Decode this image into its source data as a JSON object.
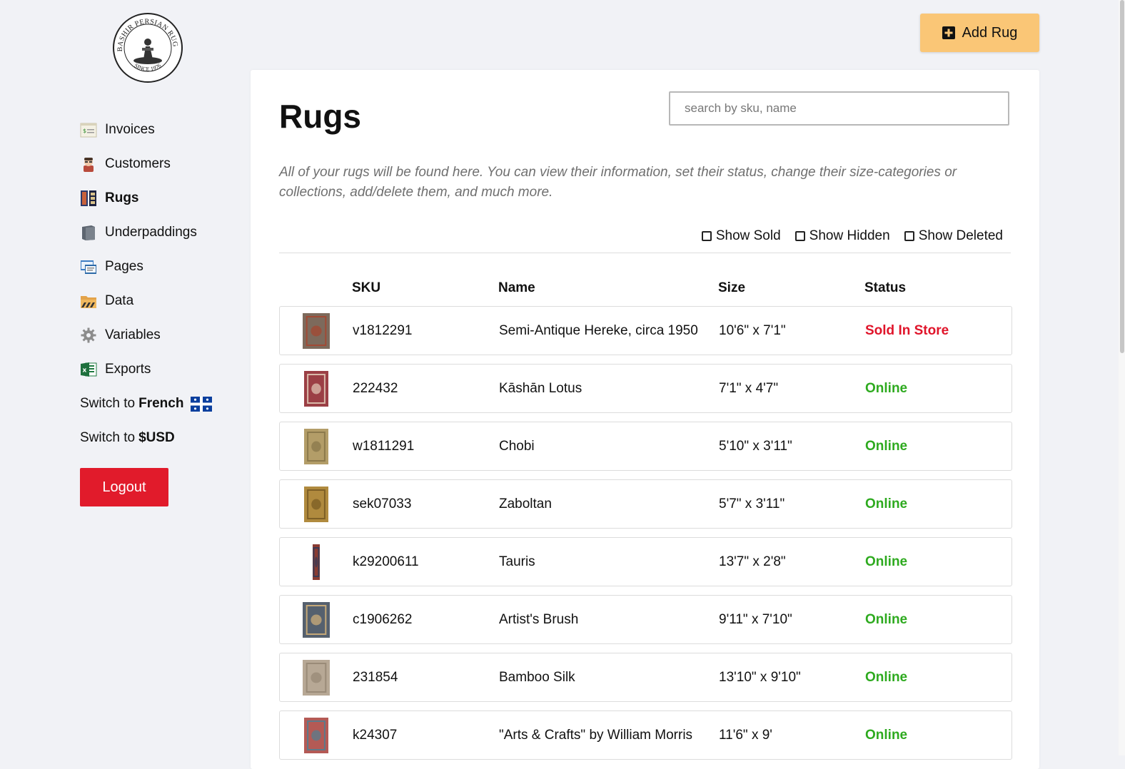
{
  "brand": {
    "logo_text_top": "BASHIR PERSIAN RUGS",
    "logo_text_bottom": "SINCE 1976"
  },
  "sidebar": {
    "items": [
      {
        "label": "Invoices",
        "icon": "invoice-icon",
        "active": false
      },
      {
        "label": "Customers",
        "icon": "customer-icon",
        "active": false
      },
      {
        "label": "Rugs",
        "icon": "rug-icon",
        "active": true
      },
      {
        "label": "Underpaddings",
        "icon": "underpadding-icon",
        "active": false
      },
      {
        "label": "Pages",
        "icon": "pages-icon",
        "active": false
      },
      {
        "label": "Data",
        "icon": "data-folder-icon",
        "active": false
      },
      {
        "label": "Variables",
        "icon": "gear-icon",
        "active": false
      },
      {
        "label": "Exports",
        "icon": "excel-icon",
        "active": false
      }
    ],
    "switch_language": {
      "prefix": "Switch to",
      "value": "French"
    },
    "switch_currency": {
      "prefix": "Switch to",
      "value": "$USD"
    },
    "logout_label": "Logout"
  },
  "header": {
    "add_label": "Add Rug"
  },
  "main": {
    "title": "Rugs",
    "search_placeholder": "search by sku, name",
    "description": "All of your rugs will be found here. You can view their information, set their status, change their size-categories or collections, add/delete them, and much more.",
    "filters": [
      {
        "label": "Show Sold",
        "checked": false
      },
      {
        "label": "Show Hidden",
        "checked": false
      },
      {
        "label": "Show Deleted",
        "checked": false
      }
    ],
    "columns": {
      "sku": "SKU",
      "name": "Name",
      "size": "Size",
      "status": "Status"
    },
    "rows": [
      {
        "sku": "v1812291",
        "name": "Semi-Antique Hereke, circa 1950",
        "size": "10'6\" x 7'1\"",
        "status": "Sold In Store",
        "status_color": "#e0142a",
        "thumb": {
          "color": "#7d6a5c",
          "accent": "#a14a35",
          "shape": "square"
        }
      },
      {
        "sku": "222432",
        "name": "Kāshān Lotus",
        "size": "7'1\" x 4'7\"",
        "status": "Online",
        "status_color": "#2eaa1f",
        "thumb": {
          "color": "#9b3f45",
          "accent": "#d9b9a9",
          "shape": "tall"
        }
      },
      {
        "sku": "w1811291",
        "name": "Chobi",
        "size": "5'10\" x 3'11\"",
        "status": "Online",
        "status_color": "#2eaa1f",
        "thumb": {
          "color": "#b39d68",
          "accent": "#8c7a4c",
          "shape": "tall"
        }
      },
      {
        "sku": "sek07033",
        "name": "Zaboltan",
        "size": "5'7\" x 3'11\"",
        "status": "Online",
        "status_color": "#2eaa1f",
        "thumb": {
          "color": "#b08a3e",
          "accent": "#7e5f26",
          "shape": "tall"
        }
      },
      {
        "sku": "k29200611",
        "name": "Tauris",
        "size": "13'7\" x 2'8\"",
        "status": "Online",
        "status_color": "#2eaa1f",
        "thumb": {
          "color": "#8a3b32",
          "accent": "#3b3b55",
          "shape": "runner"
        }
      },
      {
        "sku": "c1906262",
        "name": "Artist's Brush",
        "size": "9'11\" x 7'10\"",
        "status": "Online",
        "status_color": "#2eaa1f",
        "thumb": {
          "color": "#55606e",
          "accent": "#c4a878",
          "shape": "square"
        }
      },
      {
        "sku": "231854",
        "name": "Bamboo Silk",
        "size": "13'10\" x 9'10\"",
        "status": "Online",
        "status_color": "#2eaa1f",
        "thumb": {
          "color": "#b7a895",
          "accent": "#9a8b78",
          "shape": "square"
        }
      },
      {
        "sku": "k24307",
        "name": "\"Arts & Crafts\" by William Morris",
        "size": "11'6\" x 9'",
        "status": "Online",
        "status_color": "#2eaa1f",
        "thumb": {
          "color": "#b45a55",
          "accent": "#5c7a8a",
          "shape": "tall"
        }
      }
    ]
  }
}
